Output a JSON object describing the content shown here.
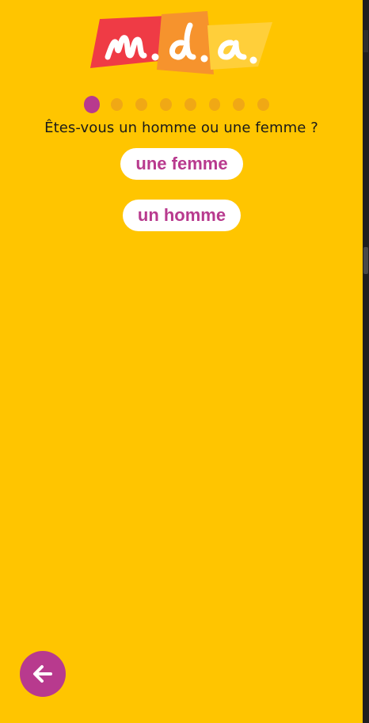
{
  "brand": {
    "logo_text": "m.d.a.",
    "colors": {
      "background": "#ffc500",
      "accent": "#b83a8e",
      "dot_inactive": "#f0a815",
      "logo_red": "#ef3b45",
      "logo_orange": "#f6932d",
      "logo_yellow": "#ffcf3a"
    }
  },
  "progress": {
    "current_step": 1,
    "total_steps": 8
  },
  "question": {
    "text": "Êtes-vous un homme ou une femme ?"
  },
  "answers": [
    {
      "label": "une femme"
    },
    {
      "label": "un homme"
    }
  ],
  "navigation": {
    "back_icon": "arrow-left-icon"
  }
}
